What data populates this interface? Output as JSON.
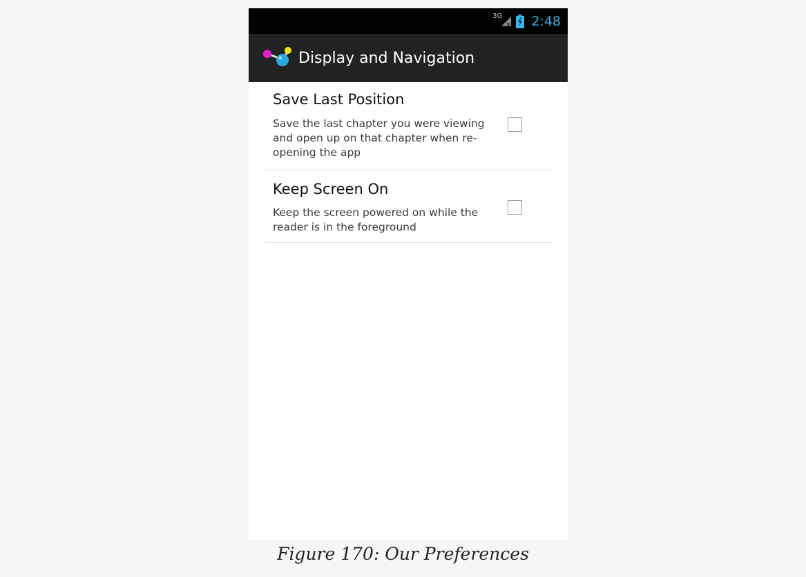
{
  "status_bar": {
    "network_type": "3G",
    "time": "2:48",
    "icons": [
      "signal-icon",
      "battery-charging-icon"
    ]
  },
  "action_bar": {
    "title": "Display and Navigation",
    "icon": "app-molecule-icon"
  },
  "preferences": [
    {
      "title": "Save Last Position",
      "summary": "Save the last chapter you were viewing and open up on that chapter when re-opening the app",
      "checked": false
    },
    {
      "title": "Keep Screen On",
      "summary": "Keep the screen powered on while the reader is in the foreground",
      "checked": false
    }
  ],
  "caption": "Figure 170: Our Preferences",
  "colors": {
    "status_bar_bg": "#000000",
    "action_bar_bg": "#222222",
    "clock_accent": "#33b5e5",
    "page_bg": "#f6f6f6"
  }
}
